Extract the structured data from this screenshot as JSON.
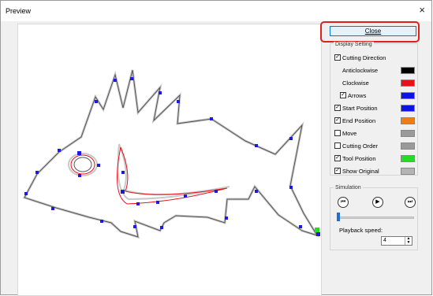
{
  "window": {
    "title": "Preview",
    "close_glyph": "×"
  },
  "panel": {
    "close_label": "Close",
    "display_setting_label": "Display Setting",
    "items": [
      {
        "label": "Cutting Direction",
        "checked": true,
        "indent": false
      },
      {
        "label": "Anticlockwise",
        "checked": null,
        "indent": true,
        "color": "#000000"
      },
      {
        "label": "Clockwise",
        "checked": null,
        "indent": true,
        "color": "#e8101a"
      },
      {
        "label": "Arrows",
        "checked": true,
        "indent": true,
        "color": "#0a14e6"
      },
      {
        "label": "Start Position",
        "checked": true,
        "indent": false,
        "color": "#0a14e6"
      },
      {
        "label": "End Position",
        "checked": true,
        "indent": false,
        "color": "#ef7d12"
      },
      {
        "label": "Move",
        "checked": false,
        "indent": false,
        "color": "#9a9a9a"
      },
      {
        "label": "Cutting Order",
        "checked": false,
        "indent": false,
        "color": "#9a9a9a"
      },
      {
        "label": "Tool Position",
        "checked": true,
        "indent": false,
        "color": "#22dd22"
      },
      {
        "label": "Show Original",
        "checked": true,
        "indent": false,
        "color": "#b4b4b4"
      }
    ],
    "simulation_label": "Simulation",
    "sim_buttons": [
      {
        "name": "skip-to-start-icon",
        "glyph": "⏮"
      },
      {
        "name": "play-icon",
        "glyph": "▶"
      },
      {
        "name": "skip-to-end-icon",
        "glyph": "⏭"
      }
    ],
    "playback_progress": 0.0,
    "playback_speed_label": "Playback speed:",
    "playback_speed_value": "4",
    "check_glyph": "✓"
  },
  "colors": {
    "accent": "#0078d7",
    "highlight": "#e0201c",
    "path_outline": "#555555",
    "path_red": "#e8101a",
    "arrow_blue": "#1a1ae0",
    "tool_green": "#22dd22"
  }
}
